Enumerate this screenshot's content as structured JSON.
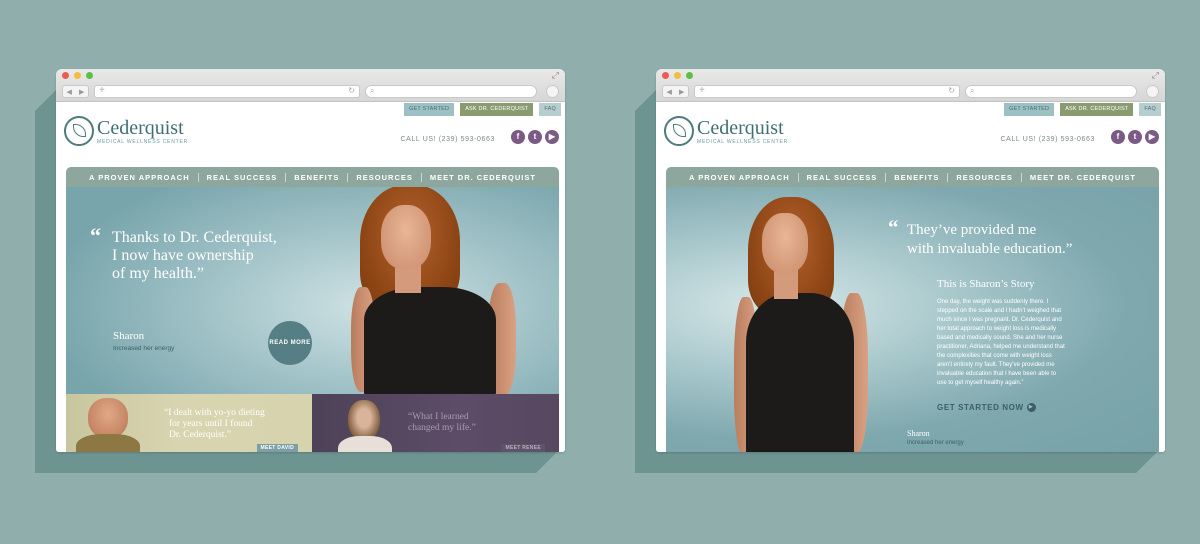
{
  "browser": {
    "back_glyph": "◀",
    "forward_glyph": "▶",
    "new_tab_glyph": "+",
    "reload_glyph": "↻",
    "search_glyph": "⌕",
    "expand_glyph": "⤢"
  },
  "site": {
    "top_buttons": {
      "get_started": "GET STARTED",
      "ask": "ASK DR. CEDERQUIST",
      "faq": "FAQ"
    },
    "logo": {
      "name": "Cederquist",
      "subtitle": "MEDICAL WELLNESS CENTER"
    },
    "call_us": "CALL US! (239) 593-0663",
    "social": {
      "facebook": "f",
      "twitter": "t",
      "youtube": "▶"
    },
    "nav": [
      "A PROVEN APPROACH",
      "REAL SUCCESS",
      "BENEFITS",
      "RESOURCES",
      "MEET DR. CEDERQUIST"
    ]
  },
  "left_page": {
    "quote_mark": "“",
    "quote_lines": [
      "Thanks to Dr. Cederquist,",
      "I now have ownership",
      "of my health.”"
    ],
    "person_name": "Sharon",
    "person_caption": "Increased her energy",
    "read_more": "READ MORE",
    "tiles": [
      {
        "quote_lines": [
          "“I dealt with yo-yo dieting",
          "for years until I found",
          "Dr. Cederquist.”"
        ],
        "button": "MEET DAVID"
      },
      {
        "quote_lines": [
          "“What I learned",
          "changed my life.”"
        ],
        "button": "MEET RENEE"
      }
    ]
  },
  "right_page": {
    "quote_mark": "“",
    "quote_lines": [
      "They’ve provided me",
      "with invaluable education.”"
    ],
    "story_title": "This is Sharon’s Story",
    "story_lines": [
      "One day, the weight was suddenly there. I",
      "stepped on the scale and I hadn’t weighed that",
      "much since I was pregnant. Dr. Cederquist and",
      "her total approach to weight loss is medically",
      "based and medically sound. She and her nurse",
      "practitioner, Adriana, helped me understand that",
      "the complexities that come with weight loss",
      "aren’t entirely my fault. They’ve provided me",
      "invaluable education that I have been able to",
      "use to get myself healthy again.”"
    ],
    "cta": "GET STARTED NOW",
    "cta_icon": "▶",
    "person_name": "Sharon",
    "person_caption": "Increased her energy"
  },
  "colors": {
    "background": "#8faeac",
    "teal": "#3f6f73",
    "nav": "#8da79e",
    "purple": "#7b5b86",
    "olive": "#8a9b70"
  }
}
